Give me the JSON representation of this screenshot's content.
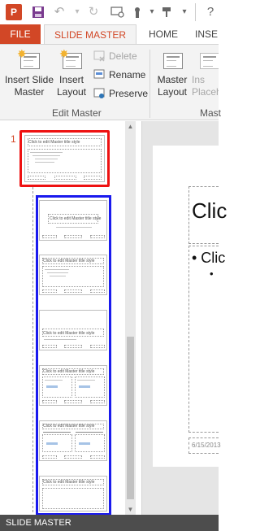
{
  "qat": {
    "app_logo": "P",
    "icons": [
      "save-icon",
      "undo-icon",
      "redo-icon",
      "presenter-view-icon",
      "touch-mode-icon",
      "customize-icon"
    ]
  },
  "tabs": {
    "file": "FILE",
    "active": "SLIDE MASTER",
    "home": "HOME",
    "insert": "INSE"
  },
  "ribbon": {
    "insert_slide_master": "Insert Slide\nMaster",
    "insert_layout": "Insert\nLayout",
    "delete": "Delete",
    "rename": "Rename",
    "preserve": "Preserve",
    "edit_master_group": "Edit Master",
    "master_layout": "Master\nLayout",
    "insert_placeholder": "Ins\nPlaceh",
    "master_group_partial": "Mast"
  },
  "thumbnails": {
    "slide_number": "1",
    "master_title": "Click to edit Master title style",
    "layout_titles": [
      "Click to edit Master title style",
      "Click to edit Master title style",
      "Click to edit Master title style",
      "Click to edit Master title style",
      "Click to edit Master title style",
      "Click to edit Master title style"
    ]
  },
  "slide": {
    "title_text": "Clic",
    "body_text": "• Clic",
    "sub_bullet": "•",
    "date_text": "6/15/2013"
  },
  "status": {
    "text": "SLIDE MASTER"
  },
  "colors": {
    "accent": "#d24726",
    "master_highlight": "#ee1111",
    "layouts_highlight": "#1a1aee",
    "status_bar": "#4d4d4d"
  }
}
